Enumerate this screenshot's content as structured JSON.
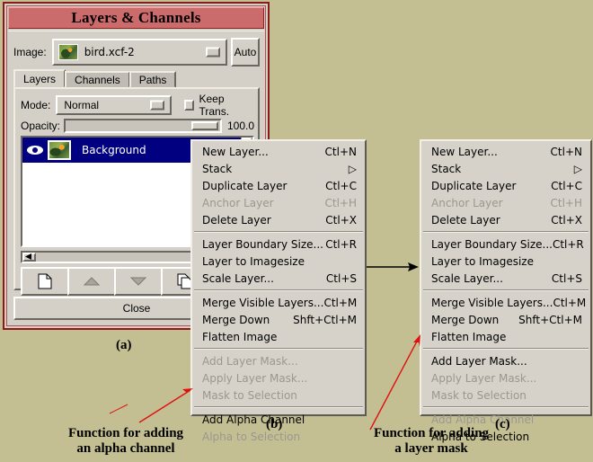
{
  "dialog": {
    "title": "Layers & Channels",
    "image_label": "Image:",
    "image_value": "bird.xcf-2",
    "auto_button": "Auto",
    "tabs": [
      {
        "label": "Layers",
        "selected": true
      },
      {
        "label": "Channels",
        "selected": false
      },
      {
        "label": "Paths",
        "selected": false
      }
    ],
    "mode_label": "Mode:",
    "mode_value": "Normal",
    "keep_trans_label": "Keep Trans.",
    "opacity_label": "Opacity:",
    "opacity_value": "100.0",
    "layer_name": "Background",
    "close_button": "Close",
    "toolbar_icons": [
      "new-layer-icon",
      "raise-layer-icon",
      "lower-layer-icon",
      "duplicate-layer-icon",
      "anchor-layer-icon"
    ]
  },
  "menu_b": {
    "items": [
      {
        "label": "New Layer...",
        "accel": "Ctl+N",
        "disabled": false,
        "sep_after": false
      },
      {
        "label": "Stack",
        "accel": "▷",
        "disabled": false,
        "sep_after": false,
        "submenu": true
      },
      {
        "label": "Duplicate Layer",
        "accel": "Ctl+C",
        "disabled": false,
        "sep_after": false
      },
      {
        "label": "Anchor Layer",
        "accel": "Ctl+H",
        "disabled": true,
        "sep_after": false
      },
      {
        "label": "Delete Layer",
        "accel": "Ctl+X",
        "disabled": false,
        "sep_after": true
      },
      {
        "label": "Layer Boundary Size...",
        "accel": "Ctl+R",
        "disabled": false,
        "sep_after": false
      },
      {
        "label": "Layer to Imagesize",
        "accel": "",
        "disabled": false,
        "sep_after": false
      },
      {
        "label": "Scale Layer...",
        "accel": "Ctl+S",
        "disabled": false,
        "sep_after": true
      },
      {
        "label": "Merge Visible Layers...",
        "accel": "Ctl+M",
        "disabled": false,
        "sep_after": false
      },
      {
        "label": "Merge Down",
        "accel": "Shft+Ctl+M",
        "disabled": false,
        "sep_after": false
      },
      {
        "label": "Flatten Image",
        "accel": "",
        "disabled": false,
        "sep_after": true
      },
      {
        "label": "Add Layer Mask...",
        "accel": "",
        "disabled": true,
        "sep_after": false
      },
      {
        "label": "Apply Layer Mask...",
        "accel": "",
        "disabled": true,
        "sep_after": false
      },
      {
        "label": "Mask to Selection",
        "accel": "",
        "disabled": true,
        "sep_after": true
      },
      {
        "label": "Add Alpha Channel",
        "accel": "",
        "disabled": false,
        "sep_after": false
      },
      {
        "label": "Alpha to Selection",
        "accel": "",
        "disabled": true,
        "sep_after": false
      }
    ]
  },
  "menu_c": {
    "items": [
      {
        "label": "New Layer...",
        "accel": "Ctl+N",
        "disabled": false,
        "sep_after": false
      },
      {
        "label": "Stack",
        "accel": "▷",
        "disabled": false,
        "sep_after": false,
        "submenu": true
      },
      {
        "label": "Duplicate Layer",
        "accel": "Ctl+C",
        "disabled": false,
        "sep_after": false
      },
      {
        "label": "Anchor Layer",
        "accel": "Ctl+H",
        "disabled": true,
        "sep_after": false
      },
      {
        "label": "Delete Layer",
        "accel": "Ctl+X",
        "disabled": false,
        "sep_after": true
      },
      {
        "label": "Layer Boundary Size...",
        "accel": "Ctl+R",
        "disabled": false,
        "sep_after": false
      },
      {
        "label": "Layer to Imagesize",
        "accel": "",
        "disabled": false,
        "sep_after": false
      },
      {
        "label": "Scale Layer...",
        "accel": "Ctl+S",
        "disabled": false,
        "sep_after": true
      },
      {
        "label": "Merge Visible Layers...",
        "accel": "Ctl+M",
        "disabled": false,
        "sep_after": false
      },
      {
        "label": "Merge Down",
        "accel": "Shft+Ctl+M",
        "disabled": false,
        "sep_after": false
      },
      {
        "label": "Flatten Image",
        "accel": "",
        "disabled": false,
        "sep_after": true
      },
      {
        "label": "Add Layer Mask...",
        "accel": "",
        "disabled": false,
        "sep_after": false
      },
      {
        "label": "Apply Layer Mask...",
        "accel": "",
        "disabled": true,
        "sep_after": false
      },
      {
        "label": "Mask to Selection",
        "accel": "",
        "disabled": true,
        "sep_after": true
      },
      {
        "label": "Add Alpha Channel",
        "accel": "",
        "disabled": true,
        "sep_after": false
      },
      {
        "label": "Alpha to Selection",
        "accel": "",
        "disabled": false,
        "sep_after": false
      }
    ]
  },
  "annotations": {
    "label_a": "(a)",
    "label_b": "(b)",
    "label_c": "(c)",
    "caption_left_line1": "Function for adding",
    "caption_left_line2": "an alpha channel",
    "caption_right_line1": "Function for adding",
    "caption_right_line2": "a layer mask",
    "arrow_color": "#e01010",
    "flow_arrow_color": "#000000"
  },
  "colors": {
    "page_background": "#c4bf93",
    "titlebar": "#cc6b6b",
    "window_frame": "#8b1a1a",
    "widget_face": "#d4d0c8",
    "menu_face": "#d6d2ca",
    "selection": "#000080"
  }
}
